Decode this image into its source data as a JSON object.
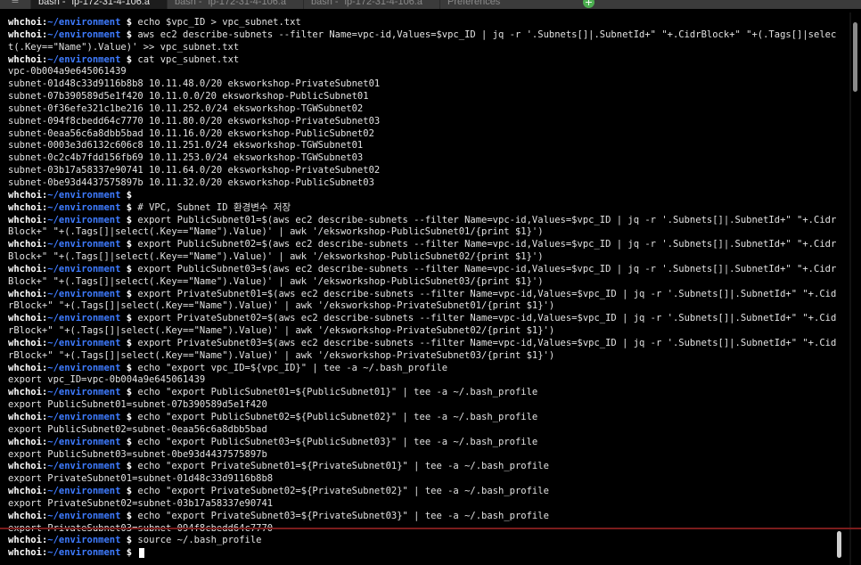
{
  "tabs": [
    {
      "label": "bash - \"ip-172-31-4-106.a",
      "active": true
    },
    {
      "label": "bash - \"ip-172-31-4-106.a",
      "active": false
    },
    {
      "label": "bash - \"ip-172-31-4-106.a",
      "active": false
    },
    {
      "label": "Preferences",
      "active": false
    }
  ],
  "terminal": {
    "prompt_user": "whchoi",
    "prompt_sep": ":",
    "prompt_path": "~/environment",
    "prompt_suffix": " $ ",
    "lines": [
      {
        "type": "cmd",
        "text": "echo $vpc_ID > vpc_subnet.txt"
      },
      {
        "type": "cmd",
        "text": "aws ec2 describe-subnets --filter Name=vpc-id,Values=$vpc_ID | jq -r '.Subnets[]|.SubnetId+\" \"+.CidrBlock+\" \"+(.Tags[]|selec"
      },
      {
        "type": "out",
        "text": "t(.Key==\"Name\").Value)' >> vpc_subnet.txt"
      },
      {
        "type": "cmd",
        "text": "cat vpc_subnet.txt"
      },
      {
        "type": "out",
        "text": "vpc-0b004a9e645061439"
      },
      {
        "type": "out",
        "text": "subnet-01d48c33d9116b8b8 10.11.48.0/20 eksworkshop-PrivateSubnet01"
      },
      {
        "type": "out",
        "text": "subnet-07b390589d5e1f420 10.11.0.0/20 eksworkshop-PublicSubnet01"
      },
      {
        "type": "out",
        "text": "subnet-0f36efe321c1be216 10.11.252.0/24 eksworkshop-TGWSubnet02"
      },
      {
        "type": "out",
        "text": "subnet-094f8cbedd64c7770 10.11.80.0/20 eksworkshop-PrivateSubnet03"
      },
      {
        "type": "out",
        "text": "subnet-0eaa56c6a8dbb5bad 10.11.16.0/20 eksworkshop-PublicSubnet02"
      },
      {
        "type": "out",
        "text": "subnet-0003e3d6132c606c8 10.11.251.0/24 eksworkshop-TGWSubnet01"
      },
      {
        "type": "out",
        "text": "subnet-0c2c4b7fdd156fb69 10.11.253.0/24 eksworkshop-TGWSubnet03"
      },
      {
        "type": "out",
        "text": "subnet-03b17a58337e90741 10.11.64.0/20 eksworkshop-PrivateSubnet02"
      },
      {
        "type": "out",
        "text": "subnet-0be93d4437575897b 10.11.32.0/20 eksworkshop-PublicSubnet03"
      },
      {
        "type": "cmd",
        "text": ""
      },
      {
        "type": "cmd",
        "text": "# VPC, Subnet ID 환경변수 저장"
      },
      {
        "type": "cmd",
        "text": "export PublicSubnet01=$(aws ec2 describe-subnets --filter Name=vpc-id,Values=$vpc_ID | jq -r '.Subnets[]|.SubnetId+\" \"+.Cidr"
      },
      {
        "type": "out",
        "text": "Block+\" \"+(.Tags[]|select(.Key==\"Name\").Value)' | awk '/eksworkshop-PublicSubnet01/{print $1}')"
      },
      {
        "type": "cmd",
        "text": "export PublicSubnet02=$(aws ec2 describe-subnets --filter Name=vpc-id,Values=$vpc_ID | jq -r '.Subnets[]|.SubnetId+\" \"+.Cidr"
      },
      {
        "type": "out",
        "text": "Block+\" \"+(.Tags[]|select(.Key==\"Name\").Value)' | awk '/eksworkshop-PublicSubnet02/{print $1}')"
      },
      {
        "type": "cmd",
        "text": "export PublicSubnet03=$(aws ec2 describe-subnets --filter Name=vpc-id,Values=$vpc_ID | jq -r '.Subnets[]|.SubnetId+\" \"+.Cidr"
      },
      {
        "type": "out",
        "text": "Block+\" \"+(.Tags[]|select(.Key==\"Name\").Value)' | awk '/eksworkshop-PublicSubnet03/{print $1}')"
      },
      {
        "type": "cmd",
        "text": "export PrivateSubnet01=$(aws ec2 describe-subnets --filter Name=vpc-id,Values=$vpc_ID | jq -r '.Subnets[]|.SubnetId+\" \"+.Cid"
      },
      {
        "type": "out",
        "text": "rBlock+\" \"+(.Tags[]|select(.Key==\"Name\").Value)' | awk '/eksworkshop-PrivateSubnet01/{print $1}')"
      },
      {
        "type": "cmd",
        "text": "export PrivateSubnet02=$(aws ec2 describe-subnets --filter Name=vpc-id,Values=$vpc_ID | jq -r '.Subnets[]|.SubnetId+\" \"+.Cid"
      },
      {
        "type": "out",
        "text": "rBlock+\" \"+(.Tags[]|select(.Key==\"Name\").Value)' | awk '/eksworkshop-PrivateSubnet02/{print $1}')"
      },
      {
        "type": "cmd",
        "text": "export PrivateSubnet03=$(aws ec2 describe-subnets --filter Name=vpc-id,Values=$vpc_ID | jq -r '.Subnets[]|.SubnetId+\" \"+.Cid"
      },
      {
        "type": "out",
        "text": "rBlock+\" \"+(.Tags[]|select(.Key==\"Name\").Value)' | awk '/eksworkshop-PrivateSubnet03/{print $1}')"
      },
      {
        "type": "cmd",
        "text": "echo \"export vpc_ID=${vpc_ID}\" | tee -a ~/.bash_profile"
      },
      {
        "type": "out",
        "text": "export vpc_ID=vpc-0b004a9e645061439"
      },
      {
        "type": "cmd",
        "text": "echo \"export PublicSubnet01=${PublicSubnet01}\" | tee -a ~/.bash_profile"
      },
      {
        "type": "out",
        "text": "export PublicSubnet01=subnet-07b390589d5e1f420"
      },
      {
        "type": "cmd",
        "text": "echo \"export PublicSubnet02=${PublicSubnet02}\" | tee -a ~/.bash_profile"
      },
      {
        "type": "out",
        "text": "export PublicSubnet02=subnet-0eaa56c6a8dbb5bad"
      },
      {
        "type": "cmd",
        "text": "echo \"export PublicSubnet03=${PublicSubnet03}\" | tee -a ~/.bash_profile"
      },
      {
        "type": "out",
        "text": "export PublicSubnet03=subnet-0be93d4437575897b"
      },
      {
        "type": "cmd",
        "text": "echo \"export PrivateSubnet01=${PrivateSubnet01}\" | tee -a ~/.bash_profile"
      },
      {
        "type": "out",
        "text": "export PrivateSubnet01=subnet-01d48c33d9116b8b8"
      },
      {
        "type": "cmd",
        "text": "echo \"export PrivateSubnet02=${PrivateSubnet02}\" | tee -a ~/.bash_profile"
      },
      {
        "type": "out",
        "text": "export PrivateSubnet02=subnet-03b17a58337e90741"
      },
      {
        "type": "cmd",
        "text": "echo \"export PrivateSubnet03=${PrivateSubnet03}\" | tee -a ~/.bash_profile"
      },
      {
        "type": "out",
        "text": "export PrivateSubnet03=subnet-094f8cbedd64c7770"
      },
      {
        "type": "cmd",
        "text": "source ~/.bash_profile"
      },
      {
        "type": "cursor",
        "text": ""
      }
    ]
  },
  "colors": {
    "background": "#000000",
    "prompt_user": "#ffffff",
    "prompt_path": "#3e7bff",
    "output": "#e2e2e2",
    "divider": "#7a1c1c",
    "add_tab": "#4caf50"
  },
  "icons": {
    "menu": "hamburger-icon",
    "close": "close-icon",
    "add": "plus-icon"
  }
}
